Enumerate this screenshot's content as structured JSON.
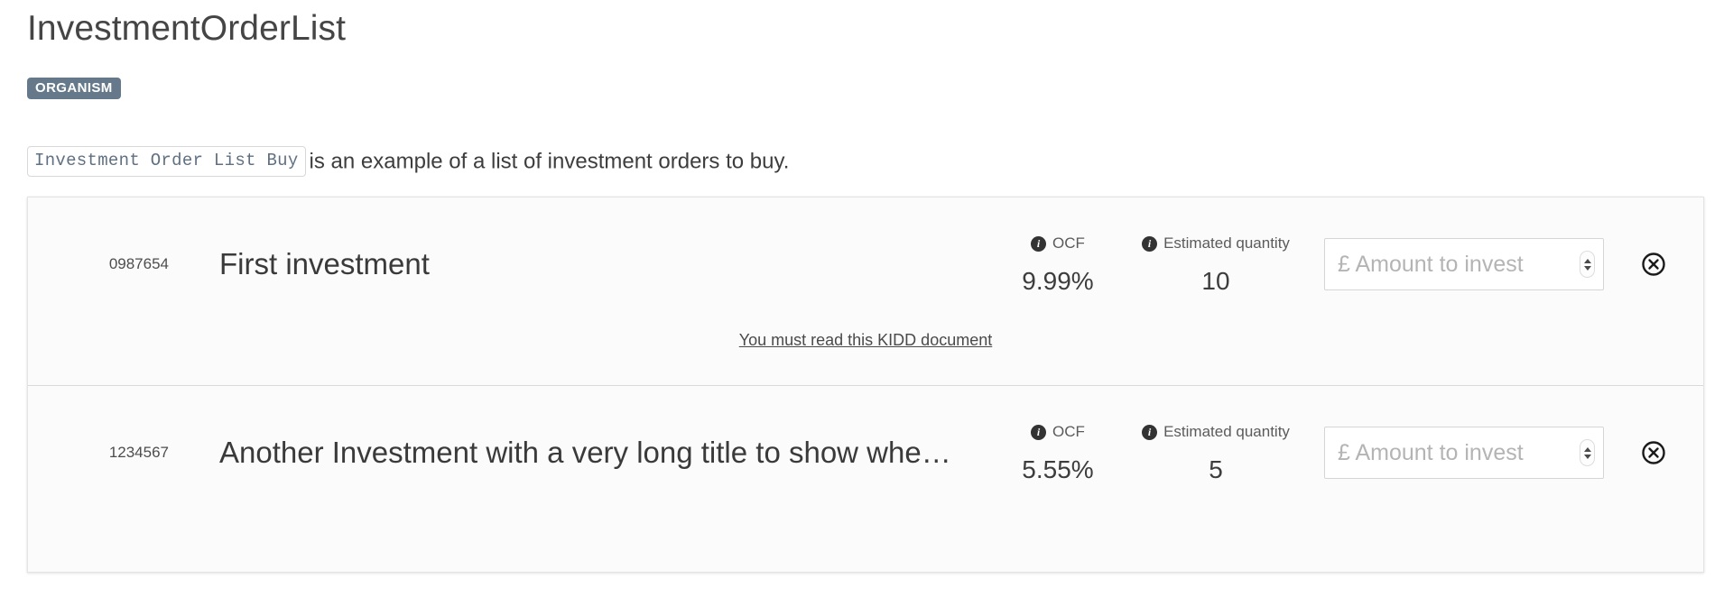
{
  "header": {
    "title": "InvestmentOrderList",
    "badge": "ORGANISM",
    "description_code": "Investment Order List Buy",
    "description_text": "is an example of a list of investment orders to buy."
  },
  "columns": {
    "ocf_label": "OCF",
    "quantity_label": "Estimated quantity",
    "amount_placeholder": "£ Amount to invest"
  },
  "icons": {
    "info": "i",
    "remove": "circled-x"
  },
  "orders": [
    {
      "id": "0987654",
      "name": "First investment",
      "ocf": "9.99%",
      "estimated_quantity": "10",
      "amount_value": "",
      "kidd_link": "You must read this KIDD document",
      "has_kidd_link": true
    },
    {
      "id": "1234567",
      "name": "Another Investment with a very long title to show whe…",
      "ocf": "5.55%",
      "estimated_quantity": "5",
      "amount_value": "",
      "kidd_link": "",
      "has_kidd_link": false
    }
  ],
  "colors": {
    "badge_bg": "#66798a",
    "card_bg": "#fbfbfb",
    "card_border": "#e4e4e4",
    "text_primary": "#3a3a3a",
    "code_text": "#607083"
  }
}
